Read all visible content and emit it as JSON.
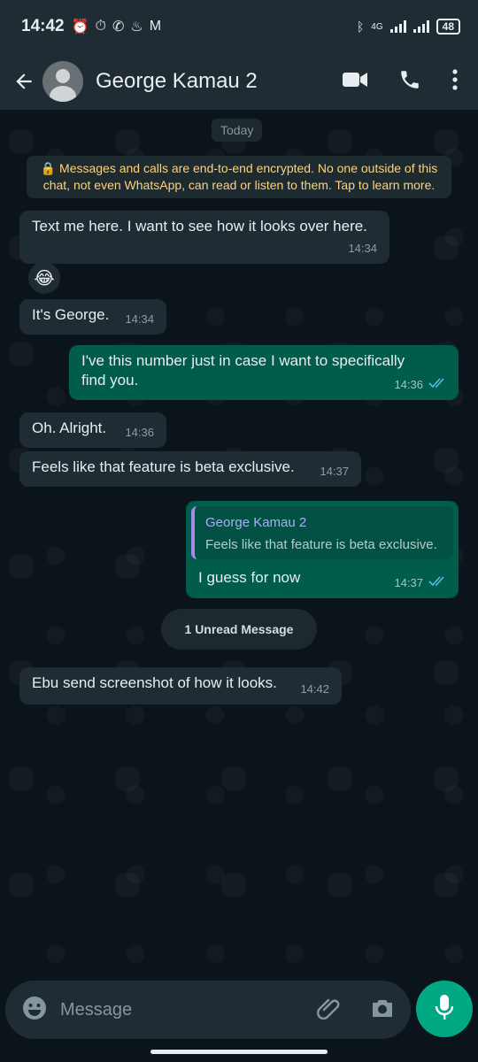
{
  "status_bar": {
    "time": "14:42",
    "network": "4G",
    "battery": "48"
  },
  "header": {
    "contact_name": "George Kamau 2"
  },
  "chat": {
    "date_chip": "Today",
    "encryption_notice": "Messages and calls are end-to-end encrypted. No one outside of this chat, not even WhatsApp, can read or listen to them. Tap to learn more.",
    "messages": [
      {
        "direction": "incoming",
        "text": "Text me here. I want to see how it looks over here.",
        "time": "14:34"
      },
      {
        "direction": "incoming",
        "text": "😂",
        "time": ""
      },
      {
        "direction": "incoming",
        "text": "It's George.",
        "time": "14:34"
      },
      {
        "direction": "outgoing",
        "text": "I've this number just in case I want to specifically find you.",
        "time": "14:36",
        "read": true
      },
      {
        "direction": "incoming",
        "text": "Oh. Alright.",
        "time": "14:36"
      },
      {
        "direction": "incoming",
        "text": "Feels like that feature is beta exclusive.",
        "time": "14:37"
      },
      {
        "direction": "outgoing",
        "reply_to": {
          "name": "George Kamau 2",
          "text": "Feels like that feature is beta exclusive."
        },
        "text": "I guess for now",
        "time": "14:37",
        "read": true
      },
      {
        "direction": "incoming",
        "text": "Ebu send screenshot of how it looks.",
        "time": "14:42"
      }
    ],
    "unread_divider": "1 Unread Message"
  },
  "composer": {
    "placeholder": "Message"
  },
  "colors": {
    "app_bar": "#1f2c34",
    "chat_bg": "#0b141a",
    "incoming_bubble": "#1f2c34",
    "outgoing_bubble": "#005c4b",
    "accent": "#00a884",
    "read_ticks": "#53bdeb"
  },
  "icons": [
    "back-arrow-icon",
    "video-call-icon",
    "phone-icon",
    "more-vertical-icon",
    "lock-icon",
    "emoji-icon",
    "attach-icon",
    "camera-icon",
    "mic-icon",
    "bluetooth-icon",
    "alarm-icon",
    "whatsapp-icon",
    "gmail-icon"
  ]
}
